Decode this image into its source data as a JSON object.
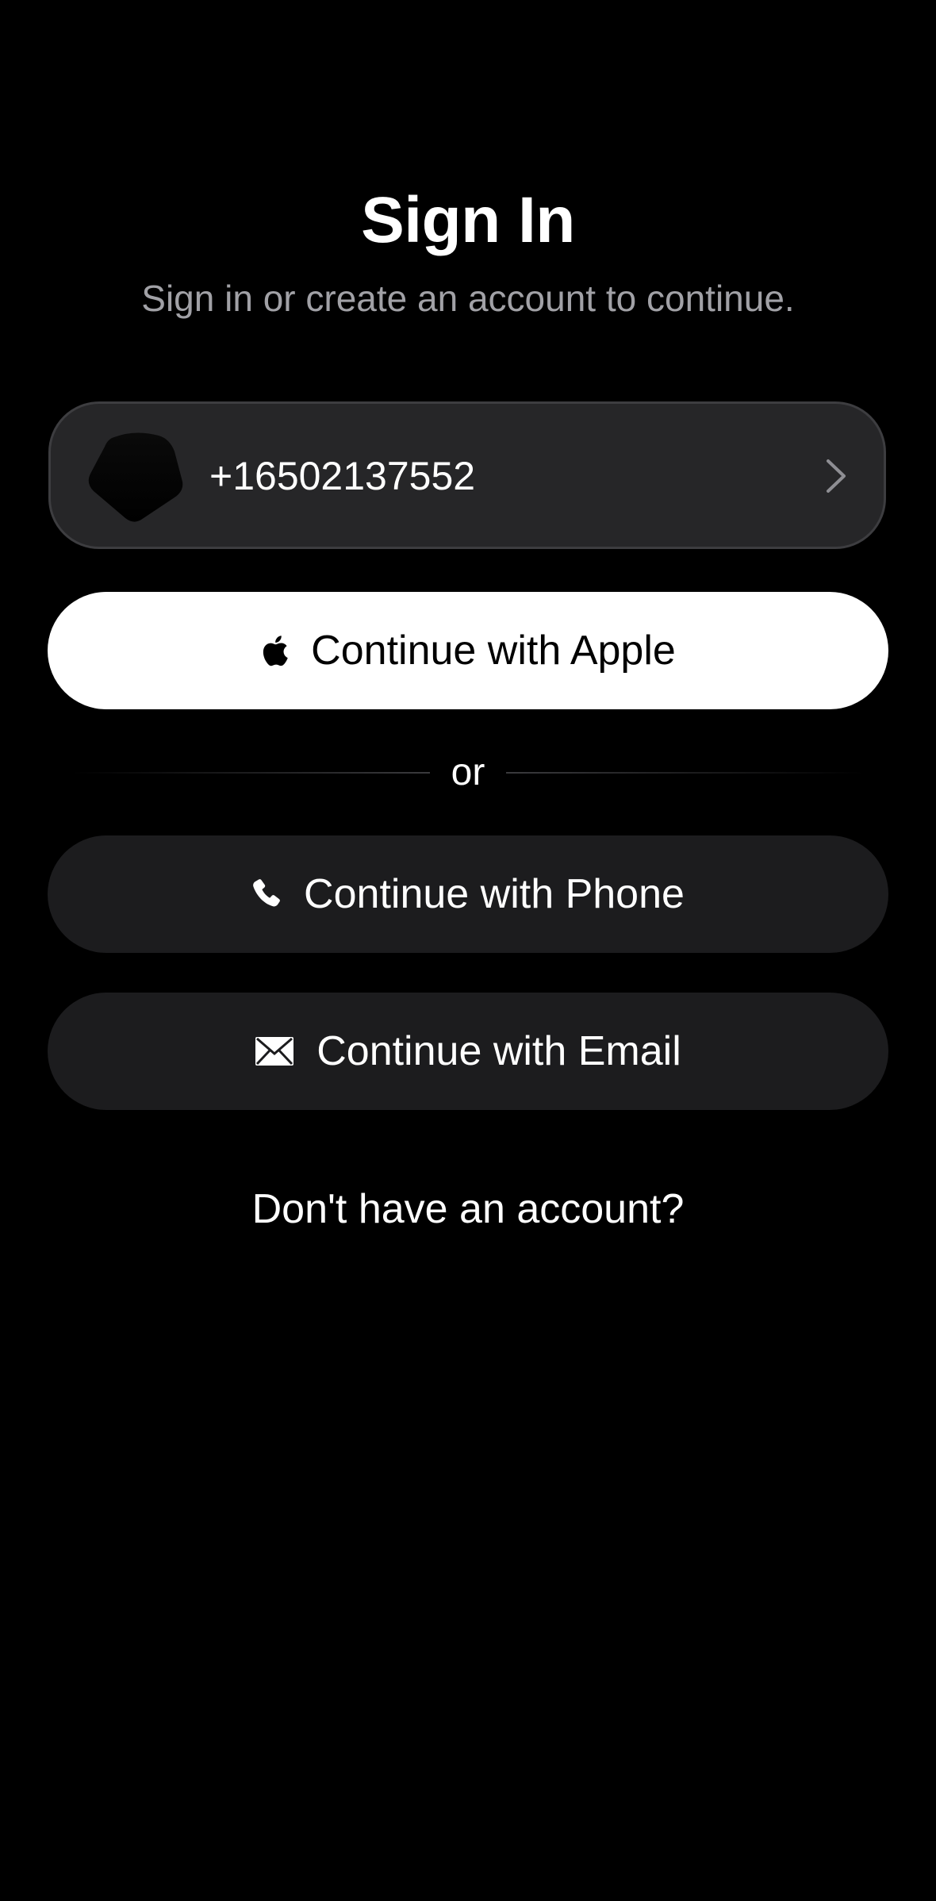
{
  "header": {
    "title": "Sign In",
    "subtitle": "Sign in or create an account to continue."
  },
  "saved_account": {
    "value": "+16502137552",
    "avatar_icon": "avatar-shape",
    "chevron_icon": "chevron-right-icon"
  },
  "buttons": {
    "apple": {
      "label": "Continue with Apple",
      "icon": "apple-icon"
    },
    "phone": {
      "label": "Continue with Phone",
      "icon": "phone-icon"
    },
    "email": {
      "label": "Continue with Email",
      "icon": "envelope-icon"
    }
  },
  "divider": {
    "text": "or"
  },
  "footer": {
    "signup_text": "Don't have an account?"
  },
  "colors": {
    "background": "#000000",
    "card": "#262628",
    "card_border": "#3d3d40",
    "dark_button": "#1c1c1e",
    "light_button": "#ffffff",
    "subtitle": "#a1a1a6"
  }
}
